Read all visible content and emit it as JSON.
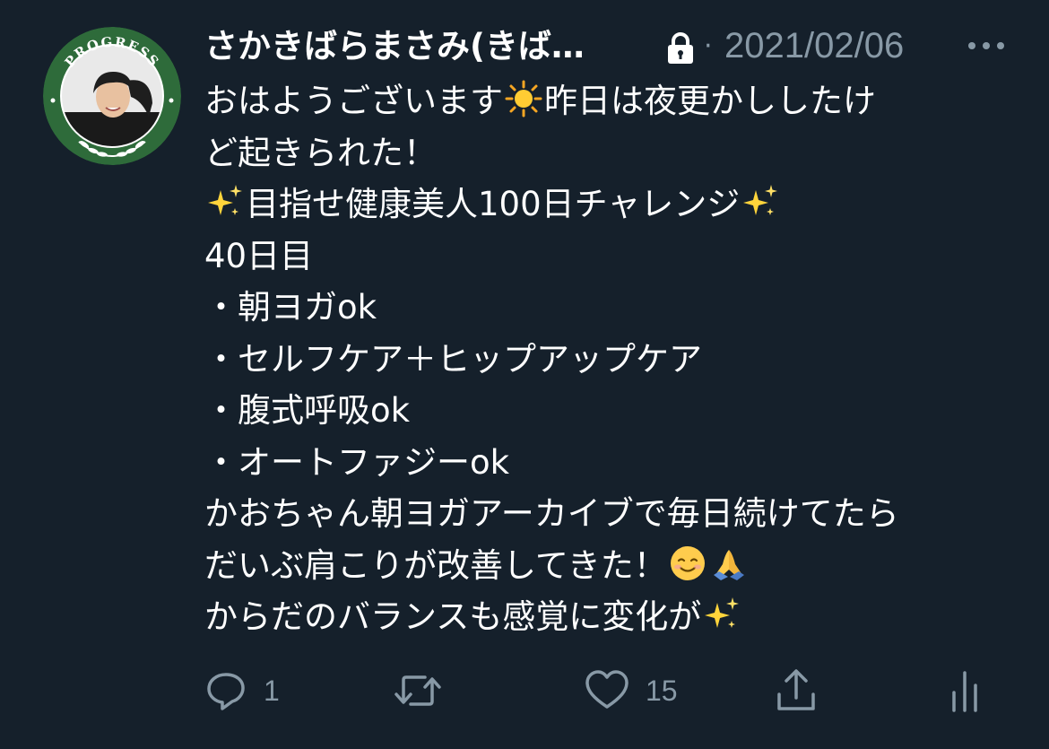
{
  "tweet": {
    "avatar": {
      "ring_text": "PROGRESS",
      "ring_color": "#2e6b3a"
    },
    "display_name": "さかきばらまさみ(きば…",
    "timestamp": "2021/02/06",
    "separator": "·",
    "icons": {
      "lock": "lock-icon",
      "more": "more-icon"
    },
    "body_lines": [
      {
        "text": "おはようございます",
        "emoji_after": "sun",
        "text2": "昨日は夜更かししたけ"
      },
      {
        "text": "ど起きられた！"
      },
      {
        "emoji_before": "sparkles",
        "text": "目指せ健康美人100日チャレンジ",
        "emoji_after": "sparkles"
      },
      {
        "text": "40日目"
      },
      {
        "text": "・朝ヨガok"
      },
      {
        "text": "・セルフケア＋ヒップアップケア"
      },
      {
        "text": "・腹式呼吸ok"
      },
      {
        "text": "・オートファジーok"
      },
      {
        "text": "かおちゃん朝ヨガアーカイブで毎日続けてたら"
      },
      {
        "text": "だいぶ肩こりが改善してきた！",
        "emoji_after": "smiling-face",
        "emoji_after2": "folded-hands"
      },
      {
        "text": "からだのバランスも感覚に変化が",
        "emoji_after": "sparkles"
      }
    ],
    "actions": {
      "reply_count": "1",
      "retweet_count": "",
      "like_count": "15"
    },
    "colors": {
      "background": "#15202b",
      "text": "#ffffff",
      "muted": "#8899a6"
    }
  }
}
